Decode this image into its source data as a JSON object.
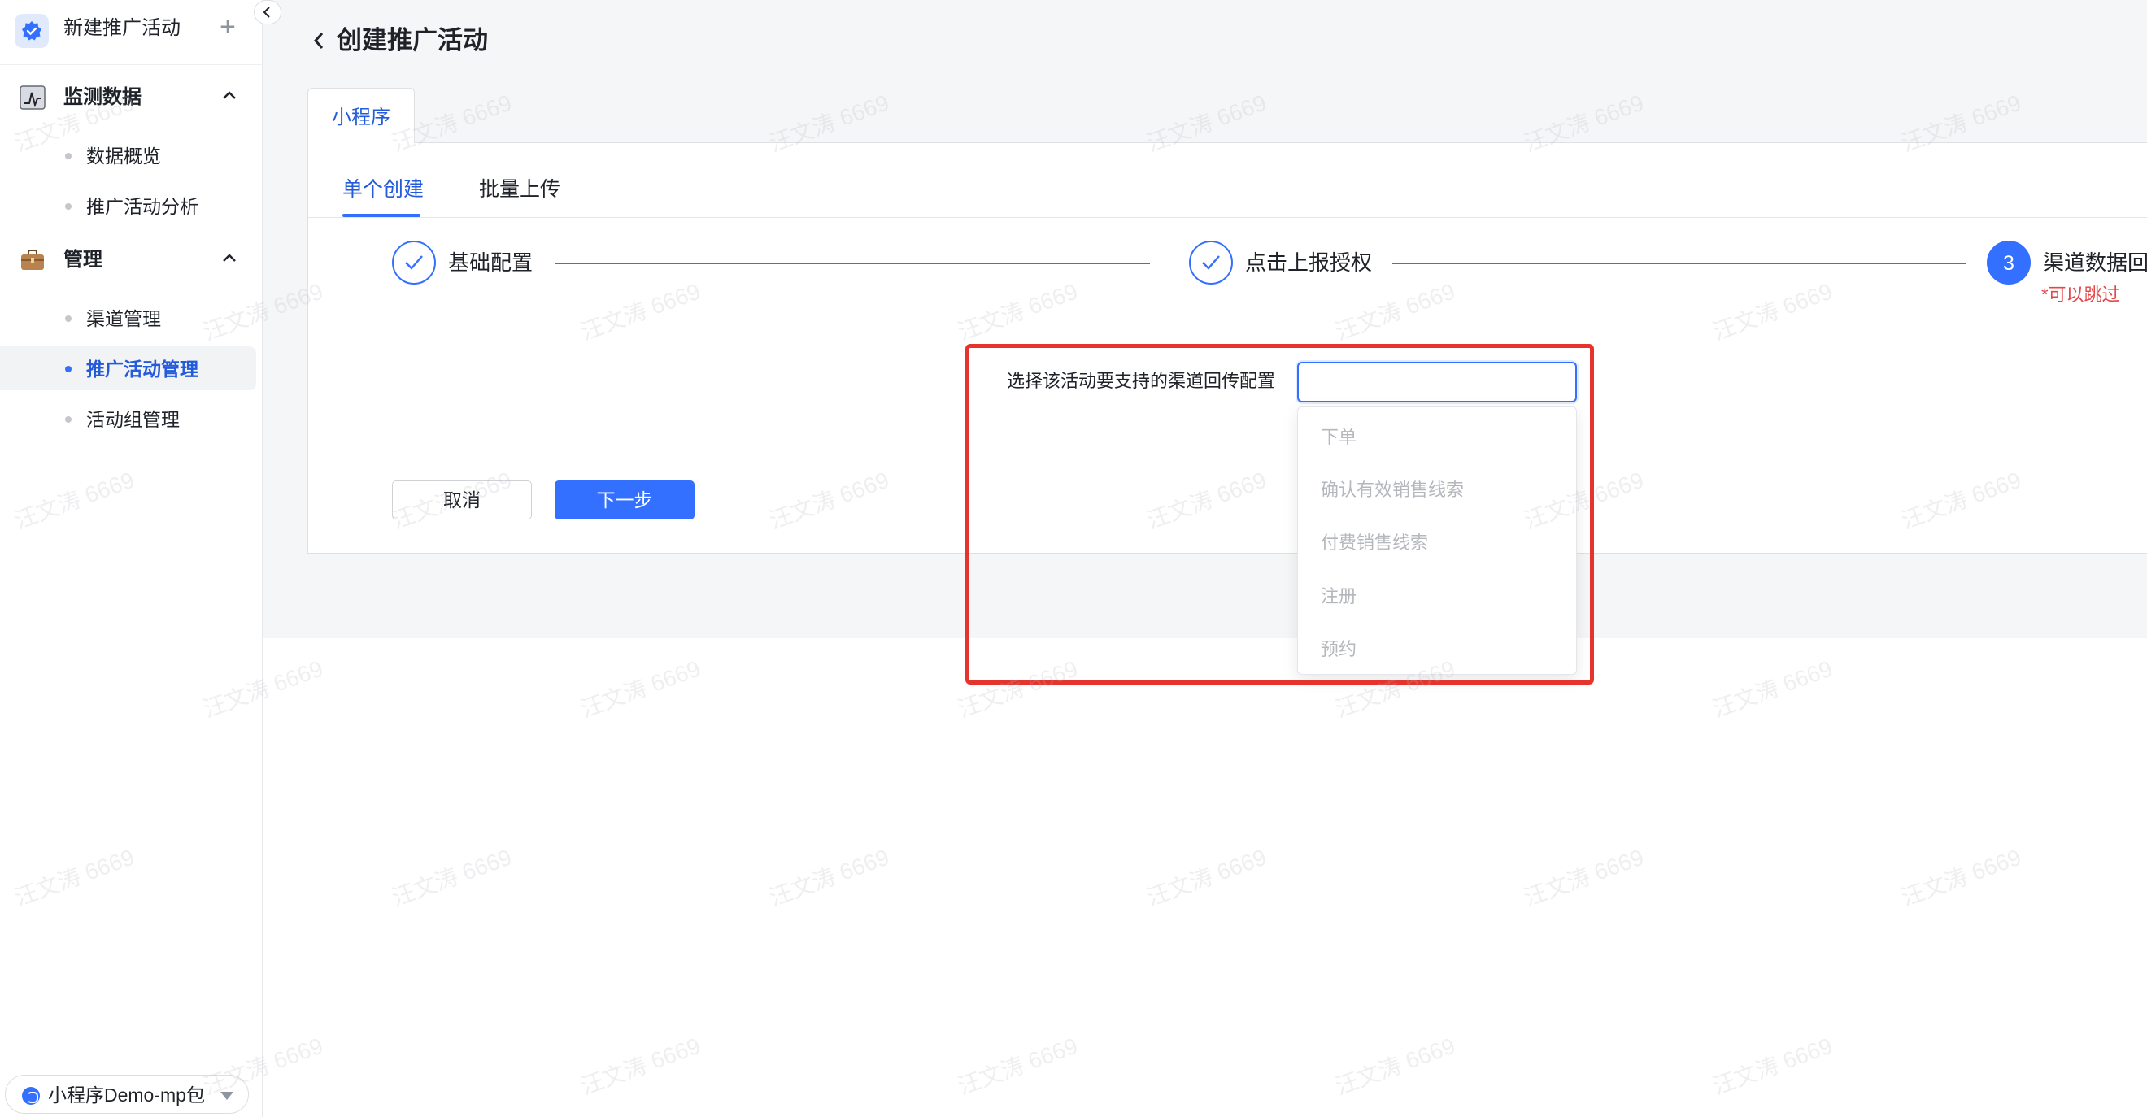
{
  "sidebar": {
    "app_title": "新建推广活动",
    "groups": [
      {
        "label": "监测数据",
        "items": [
          {
            "label": "数据概览"
          },
          {
            "label": "推广活动分析"
          }
        ]
      },
      {
        "label": "管理",
        "items": [
          {
            "label": "渠道管理"
          },
          {
            "label": "推广活动管理"
          },
          {
            "label": "活动组管理"
          }
        ]
      }
    ],
    "footer": {
      "label": "小程序Demo-mp包"
    }
  },
  "header": {
    "title": "创建推广活动"
  },
  "top_tab": {
    "label": "小程序"
  },
  "sub_tabs": [
    {
      "label": "单个创建",
      "active": true
    },
    {
      "label": "批量上传",
      "active": false
    }
  ],
  "steps": [
    {
      "label": "基础配置",
      "status": "done"
    },
    {
      "label": "点击上报授权",
      "status": "done"
    },
    {
      "number": "3",
      "label": "渠道数据回",
      "note": "*可以跳过",
      "status": "current"
    }
  ],
  "form": {
    "label": "选择该活动要支持的渠道回传配置",
    "select_value": "",
    "options": [
      "下单",
      "确认有效销售线索",
      "付费销售线索",
      "注册",
      "预约"
    ]
  },
  "buttons": {
    "cancel": "取消",
    "next": "下一步"
  },
  "watermark": "汪文涛 6669",
  "colors": {
    "accent": "#3370ff",
    "highlight": "#e5342d",
    "note": "#e54545"
  }
}
